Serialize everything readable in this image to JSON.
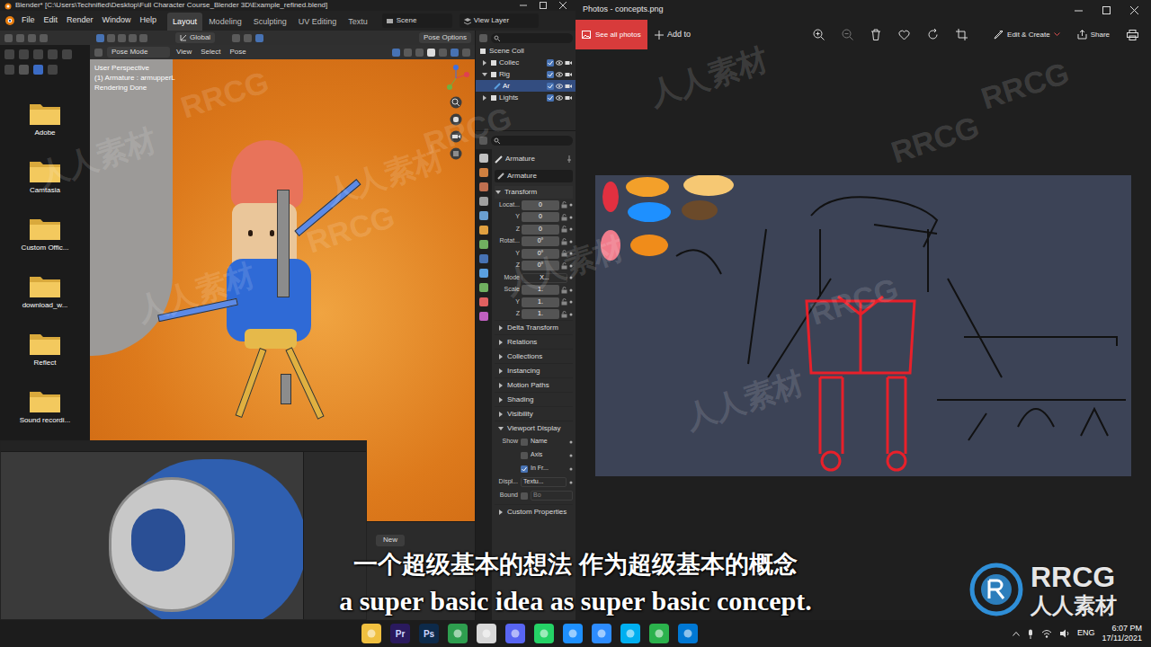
{
  "blender": {
    "title": "Blender* [C:\\Users\\Technified\\Desktop\\Full Character Course_Blender 3D\\Example_refined.blend]",
    "menus": [
      "File",
      "Edit",
      "Render",
      "Window",
      "Help"
    ],
    "workspaces": [
      {
        "label": "Layout",
        "selected": true
      },
      {
        "label": "Modeling",
        "selected": false
      },
      {
        "label": "Sculpting",
        "selected": false
      },
      {
        "label": "UV Editing",
        "selected": false
      },
      {
        "label": "Textu",
        "selected": false
      }
    ],
    "scene": "Scene",
    "view_layer": "View Layer",
    "tool": {
      "orientation": "Global",
      "options": "Pose Options"
    },
    "viewport": {
      "mode": "Pose Mode",
      "menus": [
        "View",
        "Select",
        "Pose"
      ],
      "overlay": [
        "User Perspective",
        "(1) Armature : armupperL",
        "Rendering Done"
      ],
      "new_button": "New"
    },
    "outliner": {
      "root": "Scene Coll",
      "items": [
        {
          "label": "Collec",
          "expanded": false,
          "checked": true,
          "selected": false,
          "children": []
        },
        {
          "label": "Rig",
          "expanded": true,
          "checked": true,
          "selected": false,
          "children": [
            {
              "label": "Ar",
              "checked": true,
              "selected": true
            }
          ]
        },
        {
          "label": "Lights",
          "expanded": false,
          "checked": true,
          "selected": false,
          "children": []
        }
      ]
    },
    "properties": {
      "object": "Armature",
      "data_name": "Armature",
      "transform": {
        "title": "Transform",
        "expanded": true,
        "rows": [
          {
            "label": "Locat...",
            "value": "0",
            "kind": "field"
          },
          {
            "label": "Y",
            "value": "0",
            "kind": "field"
          },
          {
            "label": "Z",
            "value": "0",
            "kind": "field"
          },
          {
            "label": "Rotat...",
            "value": "0°",
            "kind": "field"
          },
          {
            "label": "Y",
            "value": "0°",
            "kind": "field"
          },
          {
            "label": "Z",
            "value": "0°",
            "kind": "field"
          },
          {
            "label": "Mode",
            "value": "X...",
            "kind": "dropdown"
          },
          {
            "label": "Scale",
            "value": "1.",
            "kind": "field"
          },
          {
            "label": "Y",
            "value": "1.",
            "kind": "field"
          },
          {
            "label": "Z",
            "value": "1.",
            "kind": "field"
          }
        ]
      },
      "sections": [
        {
          "label": "Delta Transform",
          "expanded": false
        },
        {
          "label": "Relations",
          "expanded": false
        },
        {
          "label": "Collections",
          "expanded": false
        },
        {
          "label": "Instancing",
          "expanded": false
        },
        {
          "label": "Motion Paths",
          "expanded": false
        },
        {
          "label": "Shading",
          "expanded": false
        },
        {
          "label": "Visibility",
          "expanded": false
        }
      ],
      "viewport_display": {
        "label": "Viewport Display",
        "expanded": true,
        "show_label": "Show",
        "checks": [
          {
            "label": "Name",
            "checked": false
          },
          {
            "label": "Axis",
            "checked": false
          },
          {
            "label": "In Fr...",
            "checked": true
          }
        ],
        "display": {
          "label": "Displ...",
          "value": "Textu..."
        },
        "bounds": {
          "label": "Bound",
          "value": "Bo",
          "checked": false
        }
      },
      "custom_properties": {
        "label": "Custom Properties",
        "expanded": false
      }
    }
  },
  "desktop_icons": [
    "Adobe",
    "Camtasia",
    "Custom Offic...",
    "download_w...",
    "Reflect",
    "Sound recordi..."
  ],
  "photos": {
    "title": "Photos - concepts.png",
    "see_all": "See all photos",
    "add_to": "Add to",
    "edit_create": "Edit & Create",
    "share": "Share"
  },
  "subtitles": {
    "chinese": "一个超级基本的想法 作为超级基本的概念",
    "english": "a super basic idea as super basic concept."
  },
  "watermark": {
    "latin": "RRCG",
    "cjk": "人人素材"
  },
  "taskbar": {
    "apps": [
      {
        "kind": "icon",
        "label": "",
        "color": "#f0c040"
      },
      {
        "kind": "glyph",
        "label": "Pr",
        "color": "#2a1a5e"
      },
      {
        "kind": "glyph",
        "label": "Ps",
        "color": "#0d2a4a"
      },
      {
        "kind": "icon",
        "label": "",
        "color": "#2e9e4f"
      },
      {
        "kind": "icon",
        "label": "",
        "color": "#d8d8d8"
      },
      {
        "kind": "icon",
        "label": "",
        "color": "#5865f2"
      },
      {
        "kind": "icon",
        "label": "",
        "color": "#25d366"
      },
      {
        "kind": "icon",
        "label": "",
        "color": "#1e90ff"
      },
      {
        "kind": "icon",
        "label": "",
        "color": "#2d8cff"
      },
      {
        "kind": "icon",
        "label": "",
        "color": "#00aff0"
      },
      {
        "kind": "icon",
        "label": "",
        "color": "#2bb24c"
      },
      {
        "kind": "icon",
        "label": "",
        "color": "#0078d4"
      }
    ],
    "language": "ENG",
    "time": "6:07 PM",
    "date": "17/11/2021"
  }
}
